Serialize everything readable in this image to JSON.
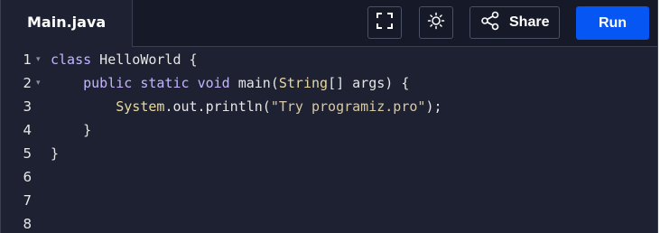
{
  "file_tab": {
    "label": "Main.java"
  },
  "toolbar": {
    "fullscreen_icon": "fullscreen-icon",
    "theme_icon": "sun-icon",
    "share_icon": "share-icon",
    "share_label": "Share",
    "run_label": "Run"
  },
  "colors": {
    "background": "#1d2131",
    "topbar": "#161928",
    "run_button": "#0556f3",
    "keyword": "#c4b5fd",
    "type": "#e8d8a0",
    "string": "#d9c9a3"
  },
  "code": {
    "lines": [
      {
        "num": "1",
        "foldable": true,
        "tokens": [
          {
            "t": "class",
            "c": "kw"
          },
          {
            "t": " HelloWorld {",
            "c": "plain"
          }
        ]
      },
      {
        "num": "2",
        "foldable": true,
        "tokens": [
          {
            "t": "    ",
            "c": "plain"
          },
          {
            "t": "public",
            "c": "kw"
          },
          {
            "t": " ",
            "c": "plain"
          },
          {
            "t": "static",
            "c": "kw"
          },
          {
            "t": " ",
            "c": "plain"
          },
          {
            "t": "void",
            "c": "kw"
          },
          {
            "t": " main(",
            "c": "plain"
          },
          {
            "t": "String",
            "c": "type"
          },
          {
            "t": "[] args) {",
            "c": "plain"
          }
        ]
      },
      {
        "num": "3",
        "foldable": false,
        "tokens": [
          {
            "t": "        ",
            "c": "plain"
          },
          {
            "t": "System",
            "c": "type"
          },
          {
            "t": ".out.println(",
            "c": "plain"
          },
          {
            "t": "\"Try programiz.pro\"",
            "c": "str"
          },
          {
            "t": ");",
            "c": "plain"
          }
        ]
      },
      {
        "num": "4",
        "foldable": false,
        "tokens": [
          {
            "t": "    }",
            "c": "plain"
          }
        ]
      },
      {
        "num": "5",
        "foldable": false,
        "tokens": [
          {
            "t": "}",
            "c": "plain"
          }
        ]
      },
      {
        "num": "6",
        "foldable": false,
        "tokens": []
      },
      {
        "num": "7",
        "foldable": false,
        "tokens": []
      },
      {
        "num": "8",
        "foldable": false,
        "tokens": []
      }
    ],
    "fold_glyph": "▾"
  }
}
